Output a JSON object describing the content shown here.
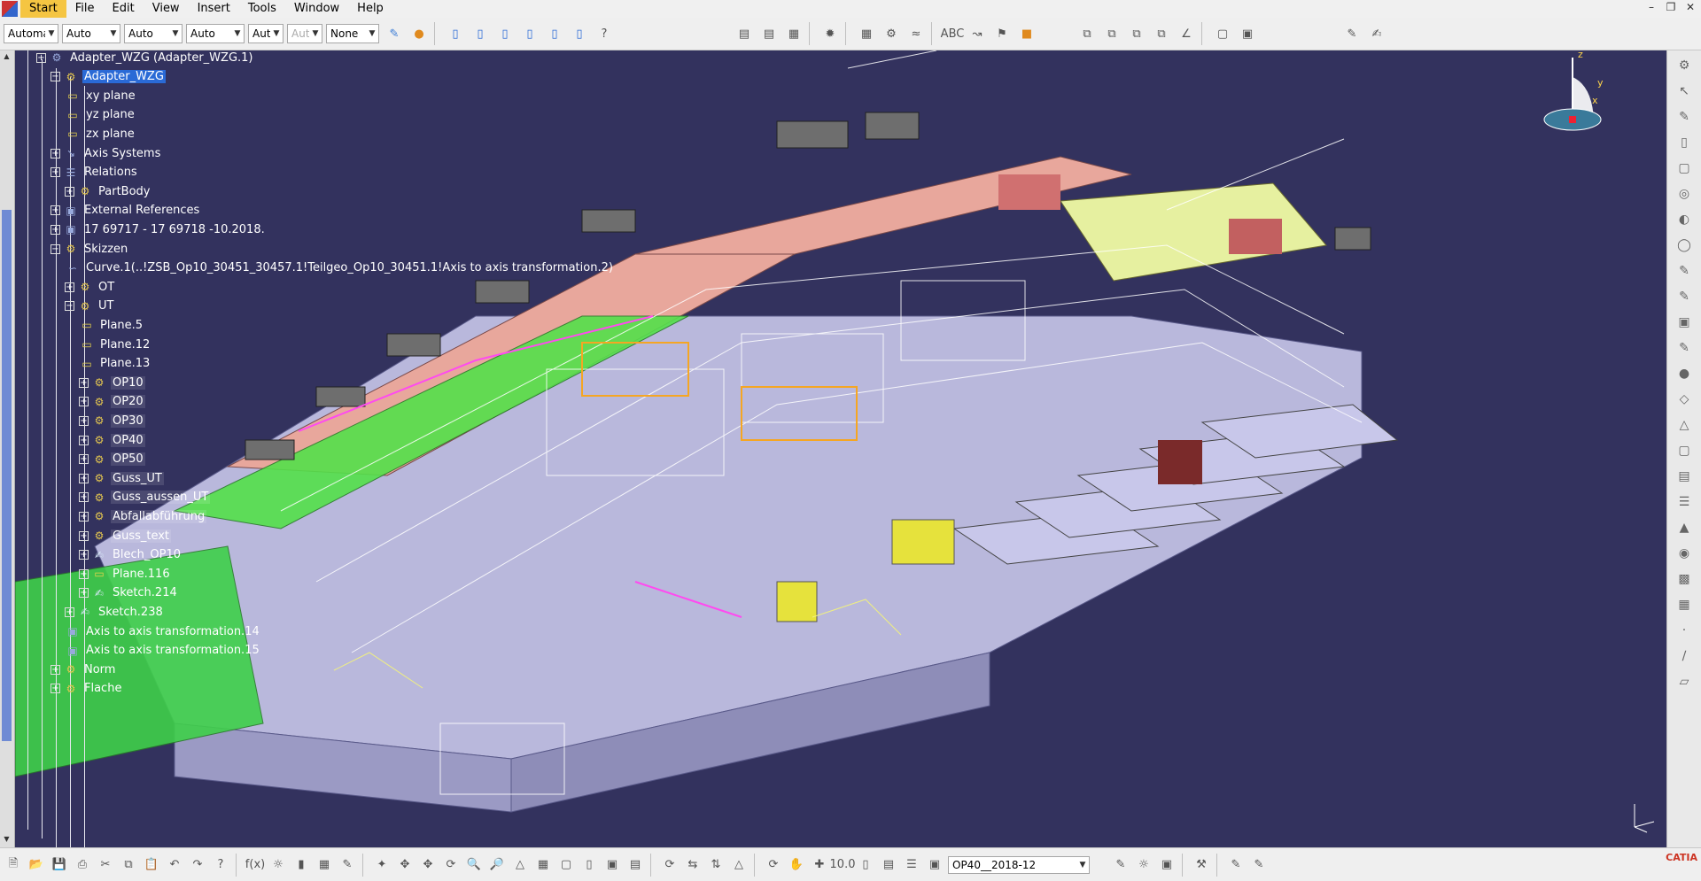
{
  "menubar": {
    "items": [
      "Start",
      "File",
      "Edit",
      "View",
      "Insert",
      "Tools",
      "Window",
      "Help"
    ],
    "active": "Start"
  },
  "toolbar": {
    "combos": [
      {
        "value": "Automa"
      },
      {
        "value": "Auto"
      },
      {
        "value": "Auto"
      },
      {
        "value": "Auto"
      },
      {
        "value": "Aut"
      },
      {
        "value": "Aut"
      },
      {
        "value": "None"
      }
    ]
  },
  "tree": {
    "nodes": [
      {
        "label": "Adapter_WZG (Adapter_WZG.1)",
        "icon": "product"
      },
      {
        "label": "Adapter_WZG",
        "icon": "gear"
      },
      {
        "label": "xy plane",
        "icon": "plane"
      },
      {
        "label": "yz plane",
        "icon": "plane"
      },
      {
        "label": "zx plane",
        "icon": "plane"
      },
      {
        "label": "Axis Systems",
        "icon": "axis"
      },
      {
        "label": "Relations",
        "icon": "relations"
      },
      {
        "label": "PartBody",
        "icon": "gear"
      },
      {
        "label": "External References",
        "icon": "external"
      },
      {
        "label": "17 69717 - 17 69718 -10.2018.",
        "icon": "external"
      },
      {
        "label": "Skizzen",
        "icon": "gear"
      },
      {
        "label": "Curve.1(..!ZSB_Op10_30451_30457.1!Teilgeo_Op10_30451.1!Axis to axis transformation.2)",
        "icon": "curve"
      },
      {
        "label": "OT",
        "icon": "gear"
      },
      {
        "label": "UT",
        "icon": "gear"
      },
      {
        "label": "Plane.5",
        "icon": "plane"
      },
      {
        "label": "Plane.12",
        "icon": "plane"
      },
      {
        "label": "Plane.13",
        "icon": "plane"
      },
      {
        "label": "OP10",
        "icon": "gear"
      },
      {
        "label": "OP20",
        "icon": "gear"
      },
      {
        "label": "OP30",
        "icon": "gear"
      },
      {
        "label": "OP40",
        "icon": "gear"
      },
      {
        "label": "OP50",
        "icon": "gear"
      },
      {
        "label": "Guss_UT",
        "icon": "gear"
      },
      {
        "label": "Guss_aussen_UT",
        "icon": "gear"
      },
      {
        "label": "Abfallabführung",
        "icon": "gear"
      },
      {
        "label": "Guss_text",
        "icon": "gear"
      },
      {
        "label": "Blech_OP10",
        "icon": "sketch"
      },
      {
        "label": "Plane.116",
        "icon": "plane"
      },
      {
        "label": "Sketch.214",
        "icon": "sketch"
      },
      {
        "label": "Sketch.238",
        "icon": "sketch"
      },
      {
        "label": "Axis to axis transformation.14",
        "icon": "external"
      },
      {
        "label": "Axis to axis transformation.15",
        "icon": "external"
      },
      {
        "label": "Norm",
        "icon": "gear"
      },
      {
        "label": "Flache",
        "icon": "gear"
      }
    ]
  },
  "compass": {
    "x": "x",
    "y": "y",
    "z": "z"
  },
  "status": {
    "combo_value": "OP40__2018-12",
    "logo": "CATIA"
  },
  "colors": {
    "viewport_bg": "#33325e",
    "highlight": "#2a6ad6",
    "menu_active": "#f5c542"
  }
}
